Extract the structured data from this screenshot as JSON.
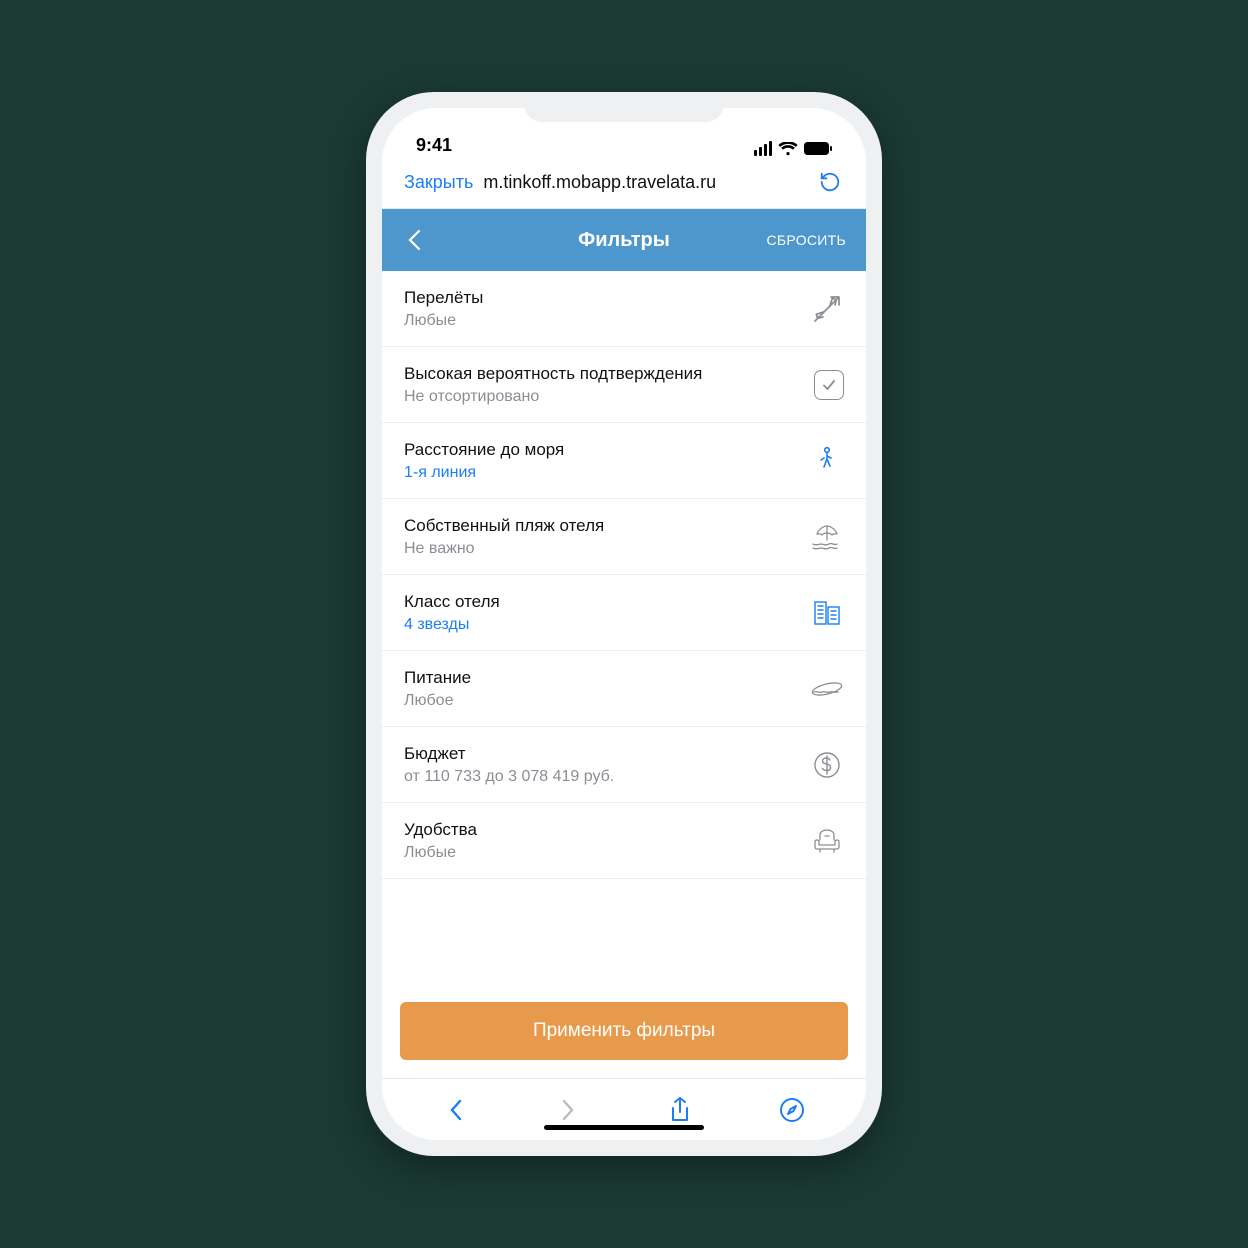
{
  "statusbar": {
    "time": "9:41"
  },
  "urlbar": {
    "close_label": "Закрыть",
    "url": "m.tinkoff.mobapp.travelata.ru"
  },
  "app_header": {
    "title": "Фильтры",
    "reset_label": "СБРОСИТЬ"
  },
  "filters": [
    {
      "title": "Перелёты",
      "value": "Любые",
      "active": false,
      "icon": "plane"
    },
    {
      "title": "Высокая вероятность подтверждения",
      "value": "Не отсортировано",
      "active": false,
      "icon": "checkbox"
    },
    {
      "title": "Расстояние до моря",
      "value": "1-я линия",
      "active": true,
      "icon": "walker"
    },
    {
      "title": "Собственный пляж отеля",
      "value": "Не важно",
      "active": false,
      "icon": "umbrella"
    },
    {
      "title": "Класс отеля",
      "value": "4 звезды",
      "active": true,
      "icon": "buildings"
    },
    {
      "title": "Питание",
      "value": "Любое",
      "active": false,
      "icon": "hotdog"
    },
    {
      "title": "Бюджет",
      "value": "от 110 733 до 3 078 419 руб.",
      "active": false,
      "icon": "dollar"
    },
    {
      "title": "Удобства",
      "value": "Любые",
      "active": false,
      "icon": "armchair"
    }
  ],
  "apply_label": "Применить фильтры"
}
